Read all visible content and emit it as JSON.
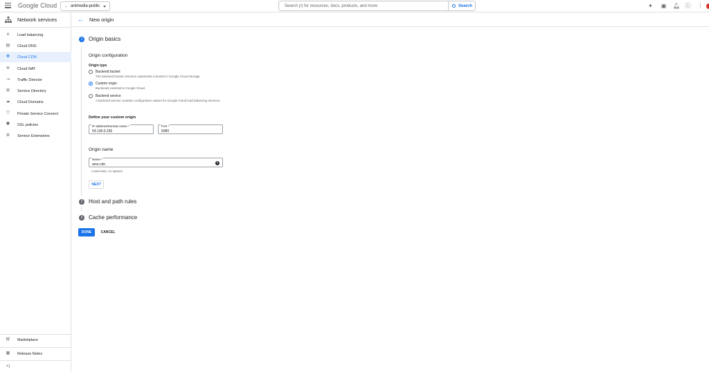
{
  "topbar": {
    "logo": "Google Cloud",
    "project": "antmedia-public",
    "search_placeholder": "Search (/) for resources, docs, products, and more",
    "search_button": "Search",
    "icons": [
      "gemini-icon",
      "terminal-icon",
      "bell-icon",
      "help-icon",
      "more-icon"
    ]
  },
  "sidebar": {
    "title": "Network services",
    "items": [
      {
        "label": "Load balancing",
        "icon": "load-balancing-icon"
      },
      {
        "label": "Cloud DNS",
        "icon": "dns-icon"
      },
      {
        "label": "Cloud CDN",
        "icon": "cdn-icon",
        "active": true
      },
      {
        "label": "Cloud NAT",
        "icon": "nat-icon"
      },
      {
        "label": "Traffic Director",
        "icon": "traffic-icon"
      },
      {
        "label": "Service Directory",
        "icon": "directory-icon"
      },
      {
        "label": "Cloud Domains",
        "icon": "domains-icon"
      },
      {
        "label": "Private Service Connect",
        "icon": "psc-icon"
      },
      {
        "label": "SSL policies",
        "icon": "shield-icon"
      },
      {
        "label": "Service Extensions",
        "icon": "extensions-icon"
      }
    ],
    "footer": [
      {
        "label": "Marketplace",
        "icon": "cart-icon"
      },
      {
        "label": "Release Notes",
        "icon": "notes-icon"
      }
    ],
    "collapse_glyph": "<|"
  },
  "main": {
    "title": "New origin",
    "steps": [
      {
        "num": "1",
        "title": "Origin basics"
      },
      {
        "num": "2",
        "title": "Host and path rules"
      },
      {
        "num": "3",
        "title": "Cache performance"
      }
    ],
    "origin_config": {
      "title": "Origin configuration",
      "type_label": "Origin type",
      "options": [
        {
          "label": "Backend bucket",
          "desc": "The backend bucket resource represents a bucket in Google Cloud Storage",
          "selected": false
        },
        {
          "label": "Custom origin",
          "desc": "Backends external to Google Cloud.",
          "selected": true
        },
        {
          "label": "Backend service",
          "desc": "A backend service contains configuration values for Google Cloud load balancing services.",
          "selected": false
        }
      ]
    },
    "custom_origin": {
      "title": "Define your custom origin",
      "ip_label": "IP address/Domain name *",
      "ip_value": "54.136.0.236",
      "port_label": "Port *",
      "port_value": "5080"
    },
    "origin_name": {
      "title": "Origin name",
      "name_label": "Name *",
      "name_value": "ams-cdn",
      "hint": "Lowercase, no spaces.",
      "help_glyph": "?"
    },
    "next_label": "NEXT",
    "done_label": "DONE",
    "cancel_label": "CANCEL"
  }
}
